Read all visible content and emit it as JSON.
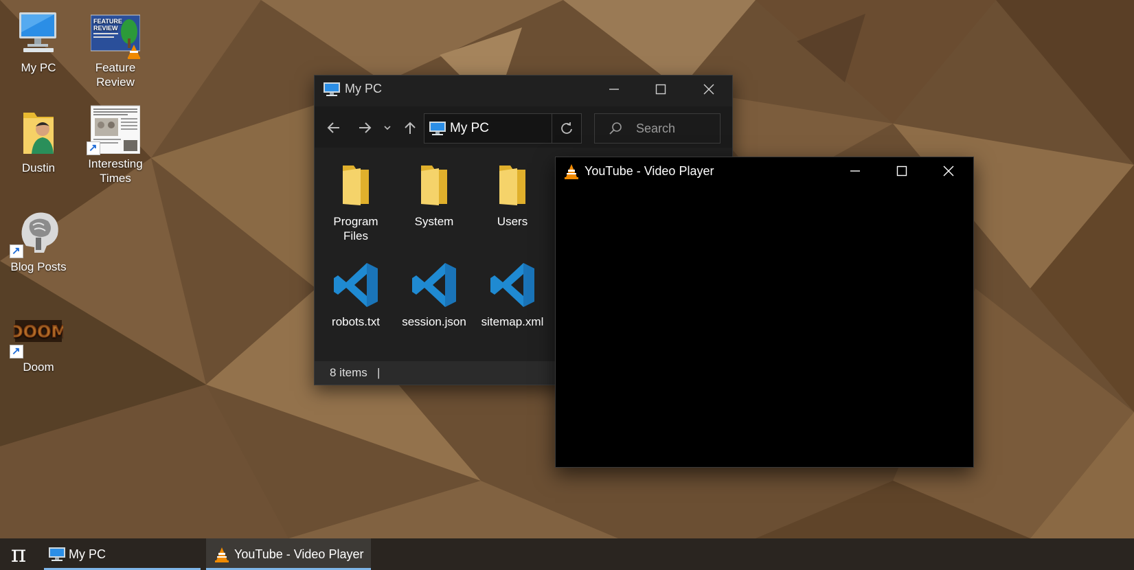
{
  "desktop": {
    "icons": [
      {
        "label": "My PC",
        "icon": "computer-icon"
      },
      {
        "label": "Feature\nReview",
        "icon": "video-thumbnail-icon",
        "overlay": "vlc-cone-icon"
      },
      {
        "label": "Dustin",
        "icon": "user-folder-icon"
      },
      {
        "label": "Interesting\nTimes",
        "icon": "document-thumbnail-icon",
        "overlay": "shortcut-arrow-icon"
      },
      {
        "label": "Blog Posts",
        "icon": "brain-scan-icon",
        "overlay": "shortcut-arrow-icon"
      },
      {
        "label": "Doom",
        "icon": "doom-logo-icon",
        "overlay": "shortcut-arrow-icon"
      }
    ],
    "thumb_text": {
      "feature_line1": "FEATURE",
      "feature_line2": "REVIEW",
      "doom": "DOOM"
    }
  },
  "explorer": {
    "title": "My PC",
    "address": "My PC",
    "search_placeholder": "Search",
    "files": [
      {
        "name": "Program\nFiles",
        "icon": "folder-icon"
      },
      {
        "name": "System",
        "icon": "folder-icon"
      },
      {
        "name": "Users",
        "icon": "folder-icon"
      },
      {
        "name": "robots.txt",
        "icon": "vscode-icon"
      },
      {
        "name": "session.json",
        "icon": "vscode-icon"
      },
      {
        "name": "sitemap.xml",
        "icon": "vscode-icon"
      }
    ],
    "status": {
      "count": "8 items",
      "separator": "|"
    }
  },
  "vlc": {
    "title": "YouTube - Video Player"
  },
  "taskbar": {
    "start_glyph": "π",
    "tasks": [
      {
        "label": "My PC",
        "icon": "computer-icon"
      },
      {
        "label": "YouTube - Video Player",
        "icon": "vlc-cone-icon"
      }
    ]
  },
  "colors": {
    "wallpaper_base": "#6e5236",
    "explorer_bg": "#202020",
    "taskbar_bg": "#2a2520",
    "folder_yellow": "#f3cc5a",
    "vscode_blue": "#1f8ad2",
    "vlc_orange": "#f08a00",
    "active_underline": "#7fb6e8"
  }
}
